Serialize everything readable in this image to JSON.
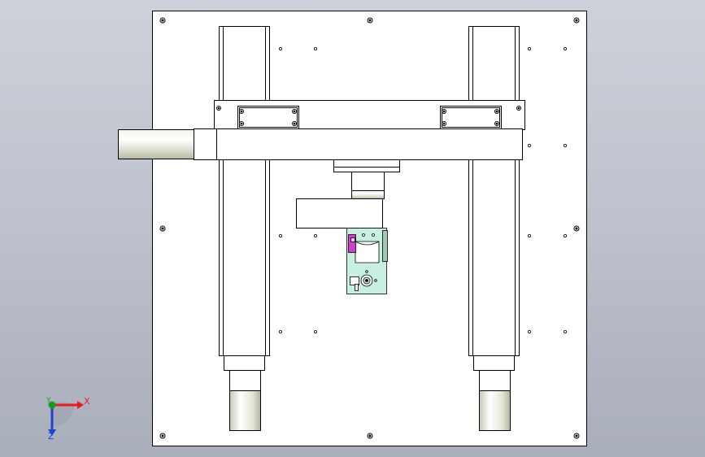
{
  "viewport": {
    "background_top": "#cdd1da",
    "background_bottom": "#a9aebb"
  },
  "triad": {
    "x_label": "X",
    "y_label": "Y",
    "z_label": "Z",
    "x_color": "#e02020",
    "y_color": "#1a9a1a",
    "z_color": "#2040d0"
  },
  "model": {
    "line_color": "#000000",
    "plate_fill": "#ffffff",
    "cylinder_color": "#e8e8d4",
    "fixture_fill": "#c8f0e0",
    "accent_magenta": "#d040d0"
  }
}
